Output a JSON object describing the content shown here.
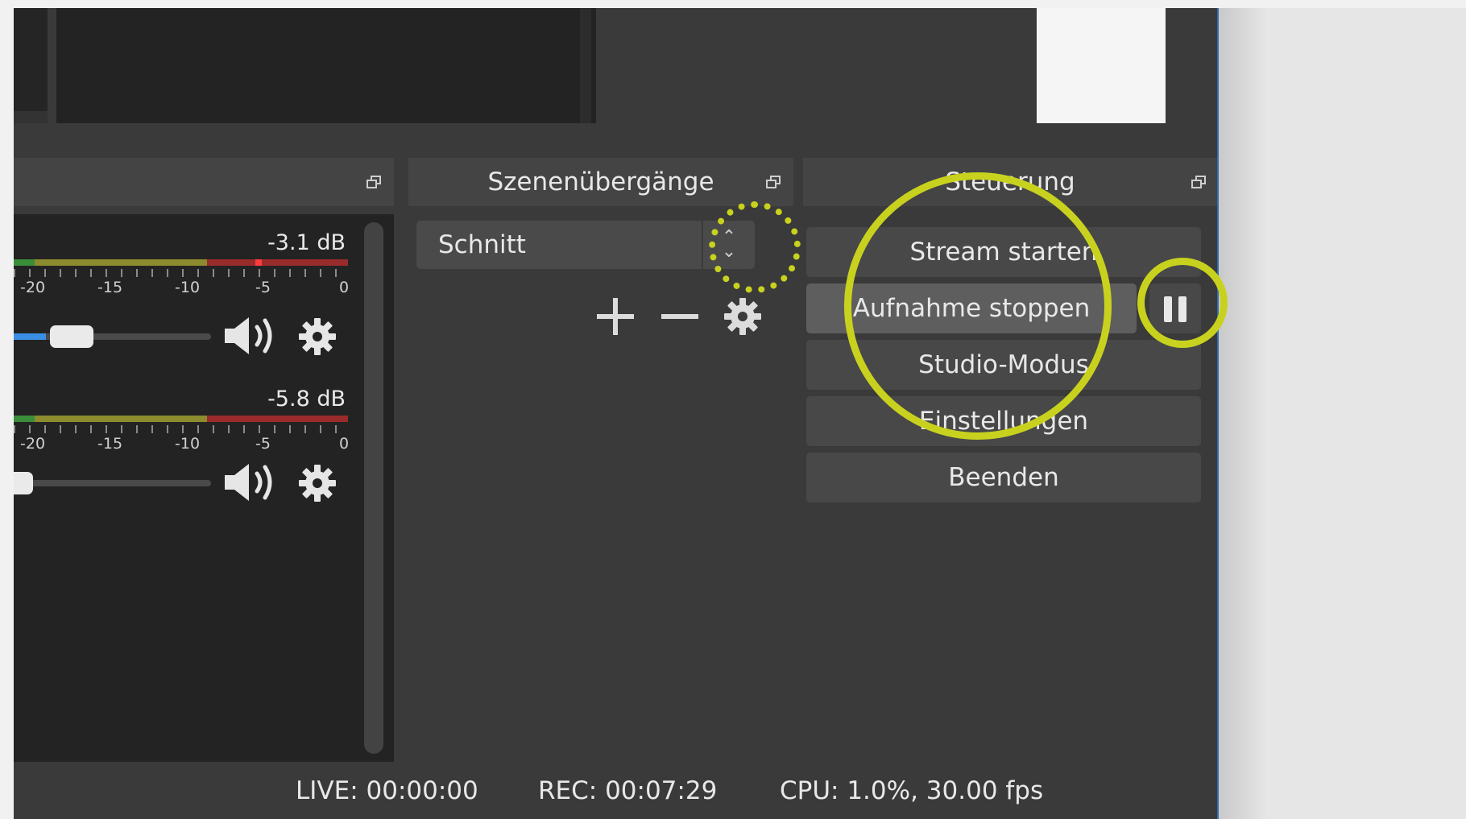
{
  "docks": {
    "transitions": {
      "title": "Szenenübergänge",
      "selected_transition": "Schnitt"
    },
    "controls": {
      "title": "Steuerung",
      "buttons": {
        "stream": "Stream starten",
        "record": "Aufnahme stoppen",
        "studio": "Studio-Modus",
        "settings": "Einstellungen",
        "exit": "Beenden"
      }
    }
  },
  "mixer": {
    "channels": [
      {
        "db": "-3.1 dB",
        "volume_fraction": 0.3
      },
      {
        "db": "-5.8 dB",
        "volume_fraction": 0.0
      }
    ],
    "tick_labels": [
      "-20",
      "-15",
      "-10",
      "-5",
      "0"
    ]
  },
  "status": {
    "live": "LIVE: 00:00:00",
    "rec": "REC: 00:07:29",
    "cpu": "CPU: 1.0%, 30.00 fps"
  },
  "colors": {
    "annotation": "#c8d21e",
    "volume_fill": "#3b8ee6",
    "window_border": "#2f6fb0"
  },
  "icons": [
    "float-icon",
    "speaker-icon",
    "gear-icon",
    "plus-icon",
    "minus-icon",
    "chevron-up-down-icon",
    "pause-icon"
  ]
}
